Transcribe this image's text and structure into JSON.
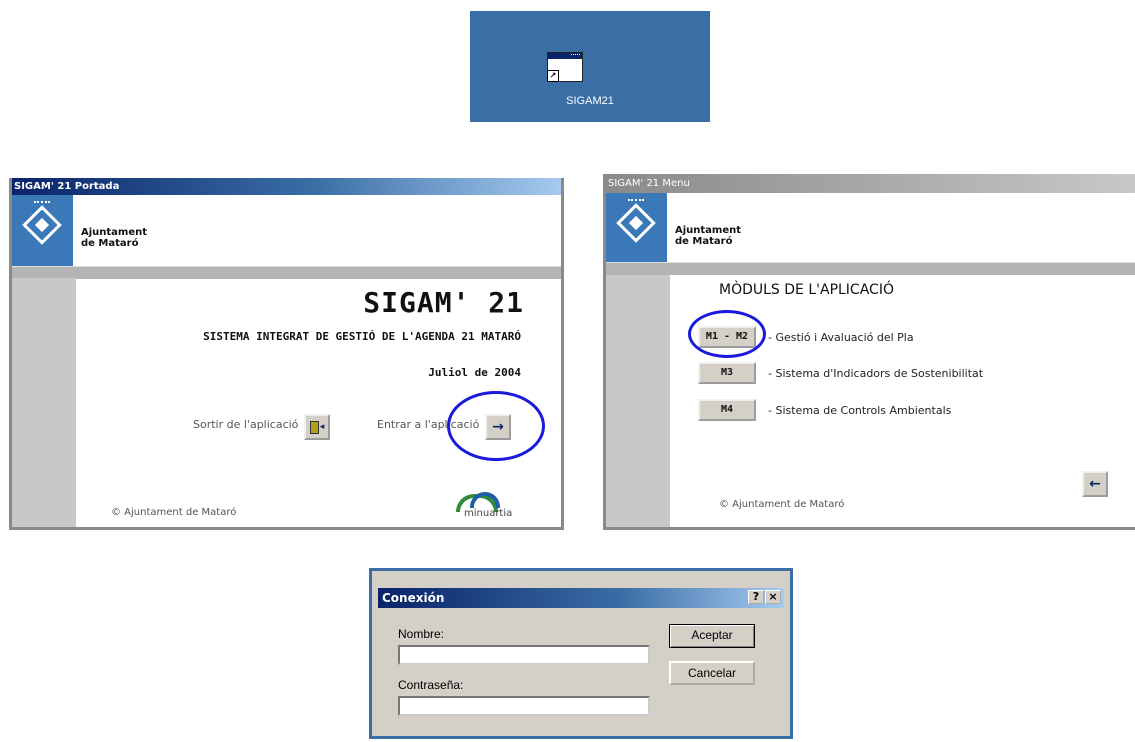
{
  "desktop": {
    "shortcut_label": "SIGAM21",
    "shortcut_icon": "application-window-icon"
  },
  "portada": {
    "window_title": "SIGAM' 21 Portada",
    "brand_line1": "Ajuntament",
    "brand_line2": "de Mataró",
    "app_title": "SIGAM' 21",
    "subtitle": "SISTEMA INTEGRAT DE GESTIÓ DE L'AGENDA 21 MATARÓ",
    "date": "Juliol de 2004",
    "exit_label": "Sortir de l'aplicació",
    "enter_label": "Entrar a l'aplicació",
    "enter_button_glyph": "→",
    "copyright": "© Ajuntament de Mataró",
    "partner_logo_text": "minuartia"
  },
  "menu": {
    "window_title": "SIGAM' 21 Menu",
    "brand_line1": "Ajuntament",
    "brand_line2": "de Mataró",
    "heading": "MÒDULS DE L'APLICACIÓ",
    "modules": [
      {
        "button": "M1 - M2",
        "label": "- Gestió  i Avaluació del Pla"
      },
      {
        "button": "M3",
        "label": "- Sistema d'Indicadors de Sostenibilitat"
      },
      {
        "button": "M4",
        "label": "- Sistema de Controls Ambientals"
      }
    ],
    "back_button_glyph": "←",
    "copyright": "© Ajuntament de Mataró"
  },
  "dialog": {
    "title": "Conexión",
    "help_glyph": "?",
    "close_glyph": "×",
    "name_label": "Nombre:",
    "name_value": "",
    "password_label": "Contraseña:",
    "password_value": "",
    "accept_label": "Aceptar",
    "cancel_label": "Cancelar"
  },
  "colors": {
    "desktop_blue": "#3a6ea5",
    "titlebar_dark": "#0a246a",
    "highlight_circle": "#1a1adc",
    "logo_blue": "#3a78b8"
  }
}
